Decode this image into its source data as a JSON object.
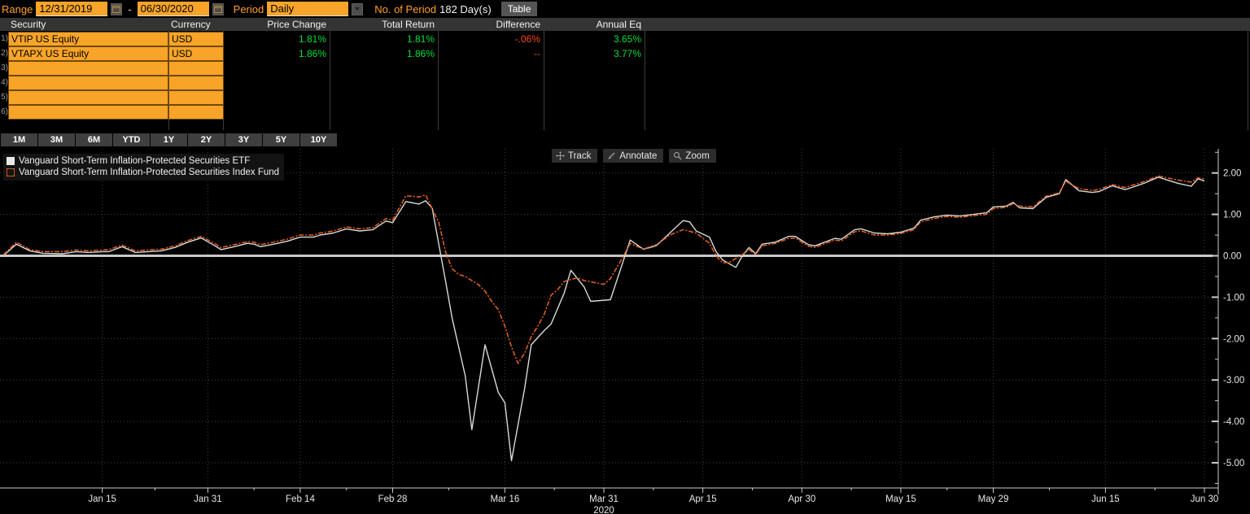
{
  "toolbar": {
    "range_label": "Range",
    "start_date": "12/31/2019",
    "separator": "-",
    "end_date": "06/30/2020",
    "period_label": "Period",
    "period_value": "Daily",
    "num_period_label": "No. of Period",
    "num_period_value": "182 Day(s)",
    "table_button": "Table"
  },
  "table": {
    "headers": [
      "Security",
      "Currency",
      "Price Change",
      "Total Return",
      "Difference",
      "Annual Eq"
    ],
    "rows": [
      {
        "n": "1)",
        "security": "VTIP US Equity",
        "currency": "USD",
        "price_change": "1.81%",
        "total_return": "1.81%",
        "difference": "-.06%",
        "annual_eq": "3.65%"
      },
      {
        "n": "2)",
        "security": "VTAPX US Equity",
        "currency": "USD",
        "price_change": "1.86%",
        "total_return": "1.86%",
        "difference": "--",
        "annual_eq": "3.77%"
      },
      {
        "n": "3)",
        "security": "",
        "currency": "",
        "price_change": "",
        "total_return": "",
        "difference": "",
        "annual_eq": ""
      },
      {
        "n": "4)",
        "security": "",
        "currency": "",
        "price_change": "",
        "total_return": "",
        "difference": "",
        "annual_eq": ""
      },
      {
        "n": "5)",
        "security": "",
        "currency": "",
        "price_change": "",
        "total_return": "",
        "difference": "",
        "annual_eq": ""
      },
      {
        "n": "6)",
        "security": "",
        "currency": "",
        "price_change": "",
        "total_return": "",
        "difference": "",
        "annual_eq": ""
      }
    ]
  },
  "range_buttons": [
    "1M",
    "3M",
    "6M",
    "YTD",
    "1Y",
    "2Y",
    "3Y",
    "5Y",
    "10Y"
  ],
  "chart": {
    "tools": [
      {
        "name": "track",
        "label": "Track"
      },
      {
        "name": "annotate",
        "label": "Annotate"
      },
      {
        "name": "zoom",
        "label": "Zoom"
      }
    ],
    "legend": [
      {
        "label": "Vanguard Short-Term Inflation-Protected Securities ETF",
        "color": "#e8e8e8",
        "style": "solid"
      },
      {
        "label": "Vanguard Short-Term Inflation-Protected Securities Index Fund",
        "color": "#e8631a",
        "style": "dashed"
      }
    ]
  },
  "colors": {
    "accent_orange": "#f7a428",
    "label_amber": "#ffa028",
    "positive_green": "#00e132",
    "negative_red": "#ff4a14",
    "series_white": "#d9d9d9",
    "series_orange": "#e8631a",
    "grid": "#434343",
    "axis": "#cccccc",
    "zero_line": "#c8c8c8"
  },
  "chart_data": {
    "type": "line",
    "x_unit": "days since 12/31/2019",
    "x_range": [
      0,
      182
    ],
    "ylim": [
      -5.6,
      2.6
    ],
    "grid": true,
    "legend_position": "top-left",
    "yticks": [
      {
        "v": 2,
        "label": "2.00"
      },
      {
        "v": 1,
        "label": "1.00"
      },
      {
        "v": 0,
        "label": "0.00"
      },
      {
        "v": -1,
        "label": "-1.00"
      },
      {
        "v": -2,
        "label": "-2.00"
      },
      {
        "v": -3,
        "label": "-3.00"
      },
      {
        "v": -4,
        "label": "-4.00"
      },
      {
        "v": -5,
        "label": "-5.00"
      }
    ],
    "yticks_minor": [
      2.5,
      1.5,
      0.5,
      -0.5,
      -1.5,
      -2.5,
      -3.5,
      -4.5,
      -5.5
    ],
    "xticks": [
      {
        "day": 15,
        "label": "Jan 15"
      },
      {
        "day": 31,
        "label": "Jan 31"
      },
      {
        "day": 45,
        "label": "Feb 14"
      },
      {
        "day": 59,
        "label": "Feb 28"
      },
      {
        "day": 76,
        "label": "Mar 16"
      },
      {
        "day": 91,
        "label": "Mar 31"
      },
      {
        "day": 106,
        "label": "Apr 15"
      },
      {
        "day": 121,
        "label": "Apr 30"
      },
      {
        "day": 136,
        "label": "May 15"
      },
      {
        "day": 150,
        "label": "May 29"
      },
      {
        "day": 167,
        "label": "Jun 15"
      },
      {
        "day": 182,
        "label": "Jun 30"
      }
    ],
    "year_label": "2020",
    "year_label_day": 91,
    "series": [
      {
        "name": "Vanguard Short-Term Inflation-Protected Securities ETF (VTIP US Equity)",
        "color": "#d9d9d9",
        "dash": "",
        "points": [
          [
            0,
            0.0
          ],
          [
            2,
            0.28
          ],
          [
            4,
            0.12
          ],
          [
            6,
            0.06
          ],
          [
            9,
            0.05
          ],
          [
            11,
            0.1
          ],
          [
            13,
            0.08
          ],
          [
            15,
            0.1
          ],
          [
            16,
            0.1
          ],
          [
            18,
            0.22
          ],
          [
            20,
            0.08
          ],
          [
            22,
            0.1
          ],
          [
            24,
            0.12
          ],
          [
            26,
            0.2
          ],
          [
            28,
            0.33
          ],
          [
            30,
            0.43
          ],
          [
            32,
            0.25
          ],
          [
            33,
            0.15
          ],
          [
            35,
            0.22
          ],
          [
            37,
            0.3
          ],
          [
            38,
            0.28
          ],
          [
            39,
            0.22
          ],
          [
            41,
            0.28
          ],
          [
            43,
            0.35
          ],
          [
            45,
            0.45
          ],
          [
            47,
            0.45
          ],
          [
            48,
            0.5
          ],
          [
            50,
            0.55
          ],
          [
            52,
            0.65
          ],
          [
            54,
            0.6
          ],
          [
            56,
            0.63
          ],
          [
            58,
            0.84
          ],
          [
            59,
            0.8
          ],
          [
            61,
            1.31
          ],
          [
            63,
            1.25
          ],
          [
            64,
            1.33
          ],
          [
            65,
            1.15
          ],
          [
            67,
            -0.6
          ],
          [
            68,
            -1.5
          ],
          [
            70,
            -2.9
          ],
          [
            71,
            -4.2
          ],
          [
            73,
            -2.15
          ],
          [
            75,
            -3.3
          ],
          [
            76,
            -3.55
          ],
          [
            77,
            -4.95
          ],
          [
            79,
            -3.2
          ],
          [
            80,
            -2.15
          ],
          [
            82,
            -1.8
          ],
          [
            83,
            -1.65
          ],
          [
            85,
            -0.9
          ],
          [
            86,
            -0.35
          ],
          [
            88,
            -0.75
          ],
          [
            89,
            -1.1
          ],
          [
            92,
            -1.06
          ],
          [
            94,
            -0.1
          ],
          [
            95,
            0.38
          ],
          [
            97,
            0.16
          ],
          [
            98,
            0.2
          ],
          [
            99,
            0.25
          ],
          [
            101,
            0.55
          ],
          [
            103,
            0.85
          ],
          [
            104,
            0.82
          ],
          [
            105,
            0.6
          ],
          [
            107,
            0.45
          ],
          [
            108,
            0.1
          ],
          [
            109,
            -0.1
          ],
          [
            111,
            -0.28
          ],
          [
            112,
            0.0
          ],
          [
            113,
            0.2
          ],
          [
            114,
            0.05
          ],
          [
            115,
            0.28
          ],
          [
            117,
            0.33
          ],
          [
            119,
            0.47
          ],
          [
            120,
            0.47
          ],
          [
            122,
            0.27
          ],
          [
            123,
            0.24
          ],
          [
            124,
            0.3
          ],
          [
            126,
            0.42
          ],
          [
            127,
            0.4
          ],
          [
            129,
            0.63
          ],
          [
            130,
            0.65
          ],
          [
            132,
            0.55
          ],
          [
            134,
            0.53
          ],
          [
            136,
            0.57
          ],
          [
            138,
            0.67
          ],
          [
            139,
            0.86
          ],
          [
            141,
            0.94
          ],
          [
            143,
            0.98
          ],
          [
            145,
            0.96
          ],
          [
            147,
            1.0
          ],
          [
            149,
            1.04
          ],
          [
            150,
            1.18
          ],
          [
            152,
            1.2
          ],
          [
            153,
            1.29
          ],
          [
            154,
            1.16
          ],
          [
            156,
            1.14
          ],
          [
            158,
            1.41
          ],
          [
            160,
            1.5
          ],
          [
            161,
            1.84
          ],
          [
            163,
            1.57
          ],
          [
            165,
            1.53
          ],
          [
            166,
            1.55
          ],
          [
            168,
            1.69
          ],
          [
            170,
            1.6
          ],
          [
            171,
            1.65
          ],
          [
            173,
            1.76
          ],
          [
            175,
            1.9
          ],
          [
            177,
            1.8
          ],
          [
            178,
            1.75
          ],
          [
            180,
            1.68
          ],
          [
            181,
            1.86
          ],
          [
            182,
            1.81
          ]
        ]
      },
      {
        "name": "Vanguard Short-Term Inflation-Protected Securities Index Fund (VTAPX US Equity)",
        "color": "#e8631a",
        "dash": "6 2 2 2",
        "points": [
          [
            0,
            0.02
          ],
          [
            2,
            0.33
          ],
          [
            4,
            0.15
          ],
          [
            6,
            0.1
          ],
          [
            9,
            0.1
          ],
          [
            11,
            0.14
          ],
          [
            13,
            0.12
          ],
          [
            15,
            0.14
          ],
          [
            16,
            0.15
          ],
          [
            18,
            0.26
          ],
          [
            20,
            0.12
          ],
          [
            22,
            0.14
          ],
          [
            24,
            0.16
          ],
          [
            26,
            0.24
          ],
          [
            28,
            0.37
          ],
          [
            30,
            0.47
          ],
          [
            32,
            0.3
          ],
          [
            33,
            0.2
          ],
          [
            35,
            0.27
          ],
          [
            37,
            0.34
          ],
          [
            38,
            0.33
          ],
          [
            39,
            0.27
          ],
          [
            41,
            0.33
          ],
          [
            43,
            0.4
          ],
          [
            45,
            0.5
          ],
          [
            47,
            0.5
          ],
          [
            48,
            0.55
          ],
          [
            50,
            0.6
          ],
          [
            52,
            0.7
          ],
          [
            54,
            0.65
          ],
          [
            56,
            0.68
          ],
          [
            58,
            0.9
          ],
          [
            59,
            0.86
          ],
          [
            61,
            1.45
          ],
          [
            63,
            1.42
          ],
          [
            64,
            1.47
          ],
          [
            66,
            0.8
          ],
          [
            67,
            0.1
          ],
          [
            68,
            -0.31
          ],
          [
            69,
            -0.45
          ],
          [
            70,
            -0.5
          ],
          [
            72,
            -0.7
          ],
          [
            73,
            -0.85
          ],
          [
            74,
            -1.1
          ],
          [
            75,
            -1.3
          ],
          [
            76,
            -1.7
          ],
          [
            77,
            -2.2
          ],
          [
            78,
            -2.6
          ],
          [
            79,
            -2.35
          ],
          [
            80,
            -1.95
          ],
          [
            81,
            -1.7
          ],
          [
            82,
            -1.4
          ],
          [
            83,
            -0.95
          ],
          [
            84,
            -0.82
          ],
          [
            85,
            -0.62
          ],
          [
            87,
            -0.53
          ],
          [
            88,
            -0.6
          ],
          [
            91,
            -0.69
          ],
          [
            92,
            -0.55
          ],
          [
            94,
            0.0
          ],
          [
            95,
            0.3
          ],
          [
            97,
            0.16
          ],
          [
            98,
            0.22
          ],
          [
            99,
            0.27
          ],
          [
            101,
            0.5
          ],
          [
            103,
            0.63
          ],
          [
            105,
            0.55
          ],
          [
            107,
            0.3
          ],
          [
            108,
            0.0
          ],
          [
            109,
            -0.17
          ],
          [
            110,
            -0.16
          ],
          [
            112,
            0.03
          ],
          [
            113,
            0.15
          ],
          [
            114,
            0.03
          ],
          [
            115,
            0.24
          ],
          [
            117,
            0.3
          ],
          [
            119,
            0.42
          ],
          [
            120,
            0.43
          ],
          [
            122,
            0.23
          ],
          [
            123,
            0.2
          ],
          [
            124,
            0.27
          ],
          [
            126,
            0.38
          ],
          [
            127,
            0.36
          ],
          [
            129,
            0.58
          ],
          [
            130,
            0.6
          ],
          [
            132,
            0.5
          ],
          [
            134,
            0.5
          ],
          [
            136,
            0.54
          ],
          [
            138,
            0.63
          ],
          [
            139,
            0.82
          ],
          [
            141,
            0.9
          ],
          [
            143,
            0.95
          ],
          [
            145,
            0.93
          ],
          [
            147,
            0.97
          ],
          [
            149,
            1.0
          ],
          [
            150,
            1.14
          ],
          [
            152,
            1.17
          ],
          [
            153,
            1.26
          ],
          [
            154,
            1.2
          ],
          [
            156,
            1.18
          ],
          [
            158,
            1.44
          ],
          [
            160,
            1.52
          ],
          [
            161,
            1.8
          ],
          [
            163,
            1.62
          ],
          [
            165,
            1.58
          ],
          [
            166,
            1.6
          ],
          [
            168,
            1.72
          ],
          [
            170,
            1.65
          ],
          [
            171,
            1.7
          ],
          [
            173,
            1.8
          ],
          [
            175,
            1.93
          ],
          [
            177,
            1.86
          ],
          [
            178,
            1.83
          ],
          [
            180,
            1.78
          ],
          [
            181,
            1.88
          ],
          [
            182,
            1.86
          ]
        ]
      }
    ]
  }
}
